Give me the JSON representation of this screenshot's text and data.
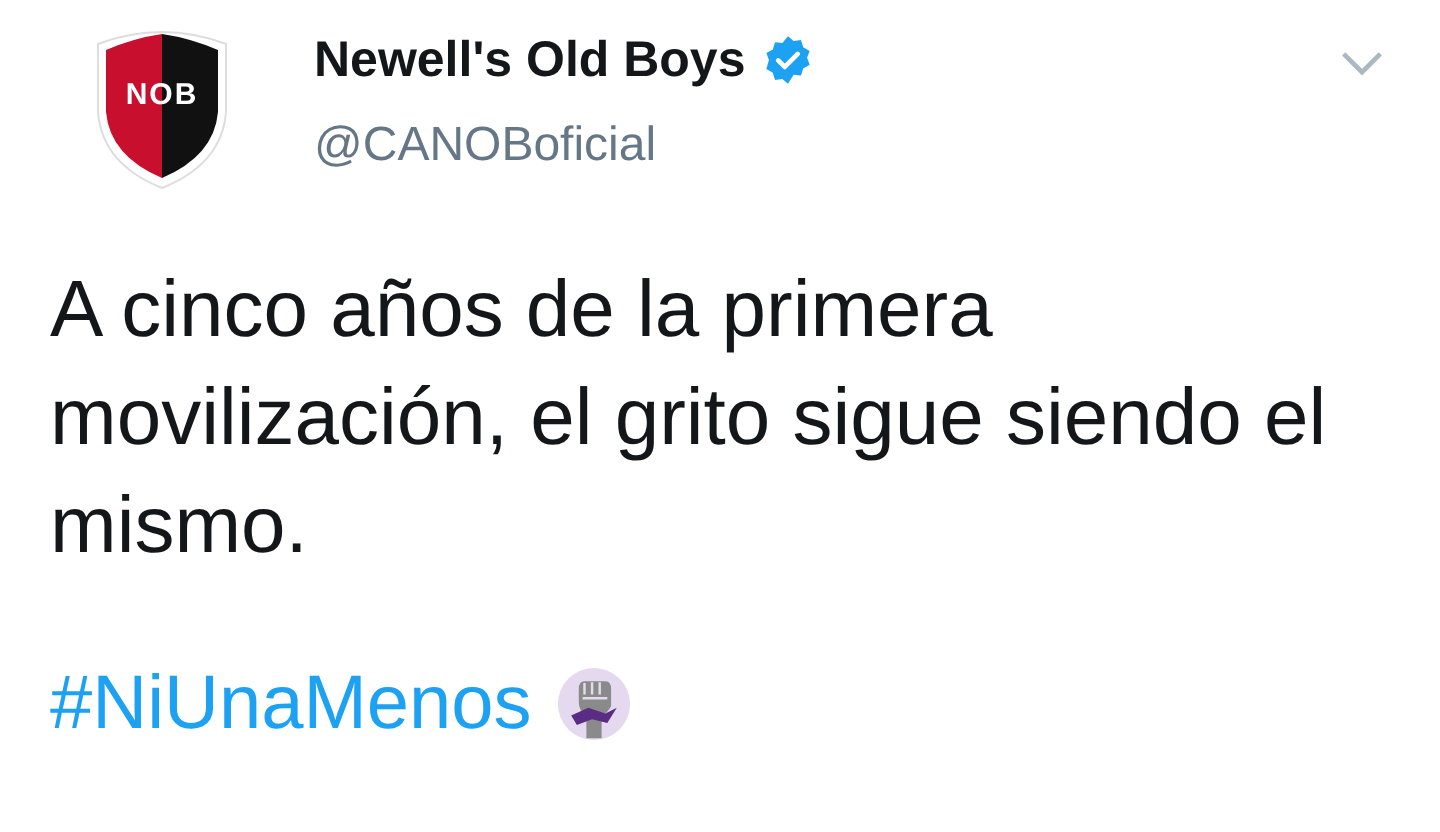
{
  "tweet": {
    "author": {
      "name": "Newell's Old Boys",
      "verified": true,
      "handle": "@CANOBoficial",
      "avatar_text": "NOB"
    },
    "text": "A cinco años de la primera movilización, el grito sigue siendo el mismo.",
    "hashtag": "#NiUnaMenos"
  }
}
